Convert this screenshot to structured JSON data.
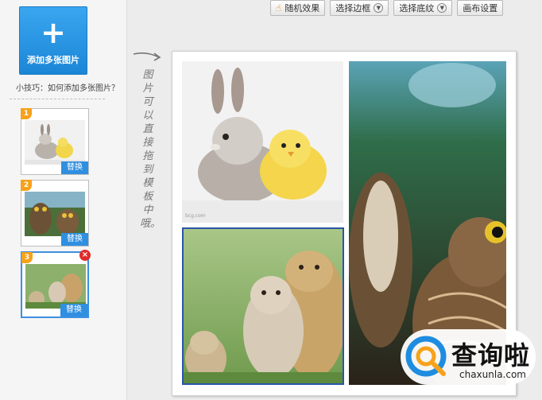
{
  "sidebar": {
    "add_button": {
      "plus": "+",
      "label": "添加多张图片"
    },
    "tip": "小技巧：如何添加多张图片？",
    "thumbnails": [
      {
        "index": "1",
        "replace_label": "替换"
      },
      {
        "index": "2",
        "replace_label": "替换"
      },
      {
        "index": "3",
        "replace_label": "替换",
        "close": "×"
      }
    ]
  },
  "toolbar": {
    "random_effect": "随机效果",
    "select_border": "选择边框",
    "select_background": "选择底纹",
    "canvas_settings": "画布设置"
  },
  "hint": {
    "vertical_text": "图片可以直接拖到模板中哦。"
  },
  "canvas": {
    "photo_a_caption": "bcg.com"
  },
  "watermark": {
    "cn": "查询啦",
    "en": "chaxunla.com"
  },
  "colors": {
    "accent": "#2f8fe0",
    "badge": "#f7a21a",
    "selected_border": "#2a55a8"
  }
}
